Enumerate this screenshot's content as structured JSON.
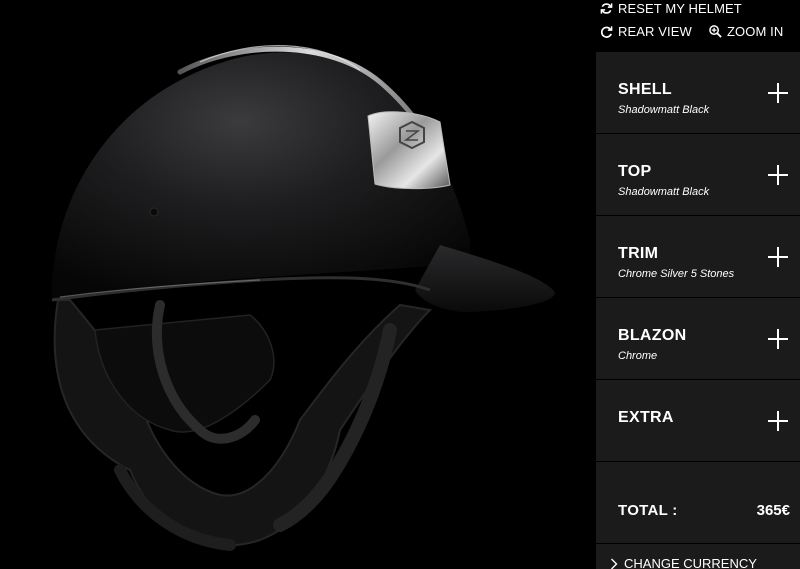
{
  "toolbar": {
    "reset_label": "RESET MY HELMET",
    "rear_label": "REAR VIEW",
    "zoom_label": "ZOOM IN",
    "reset_icon": "refresh-icon",
    "rear_icon": "rotate-icon",
    "zoom_icon": "zoom-in-icon"
  },
  "options": [
    {
      "title": "SHELL",
      "value": "Shadowmatt Black"
    },
    {
      "title": "TOP",
      "value": "Shadowmatt Black"
    },
    {
      "title": "TRIM",
      "value": "Chrome Silver 5 Stones"
    },
    {
      "title": "BLAZON",
      "value": "Chrome"
    },
    {
      "title": "EXTRA",
      "value": ""
    }
  ],
  "total": {
    "label": "TOTAL :",
    "value": "365€"
  },
  "currency": {
    "label": "CHANGE CURRENCY",
    "icon": "chevron-right-icon"
  },
  "colors": {
    "background": "#000000",
    "panel": "#1b1b1b",
    "text": "#ffffff"
  }
}
